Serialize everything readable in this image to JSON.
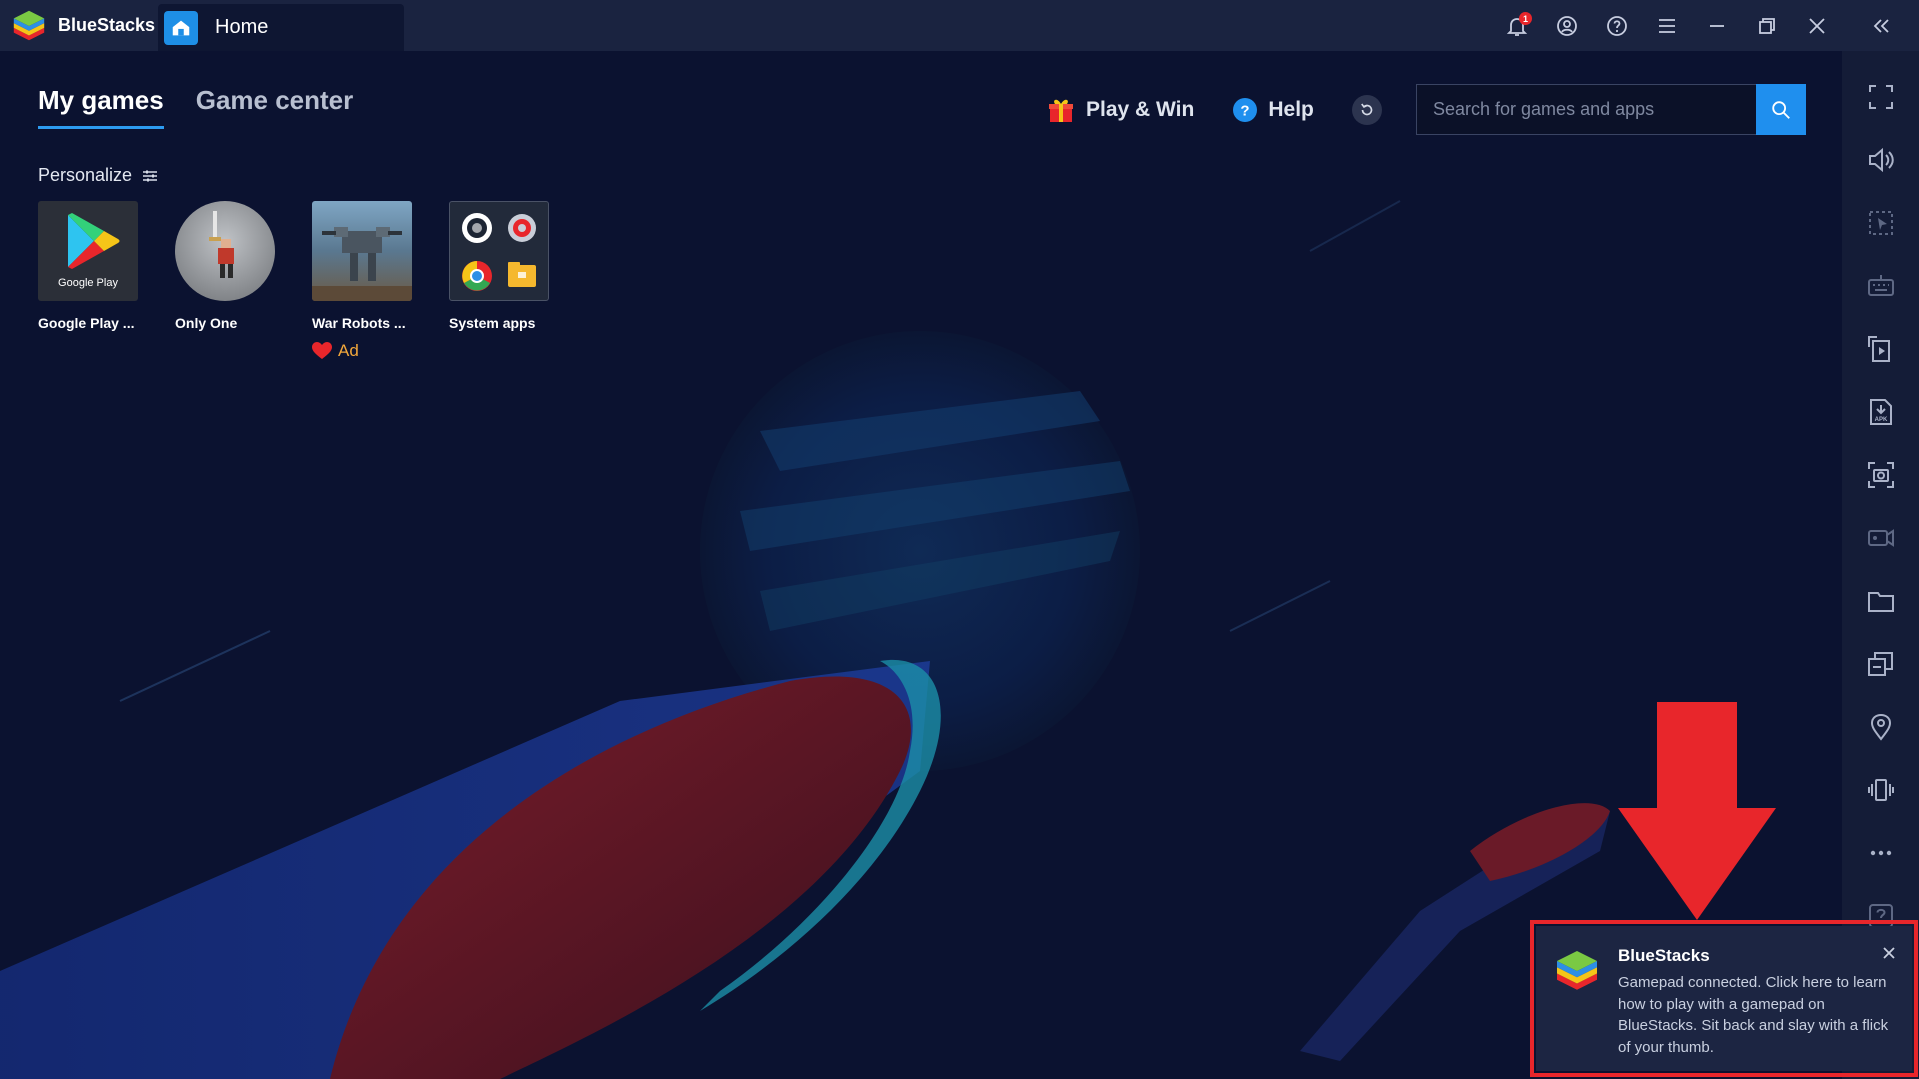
{
  "window": {
    "app_name": "BlueStacks",
    "tab_label": "Home",
    "notification_count": "1"
  },
  "nav": {
    "tabs": [
      {
        "label": "My games",
        "active": true
      },
      {
        "label": "Game center",
        "active": false
      }
    ]
  },
  "actions": {
    "play_win_label": "Play & Win",
    "help_label": "Help"
  },
  "search": {
    "placeholder": "Search for games and apps"
  },
  "personalize": {
    "label": "Personalize"
  },
  "games": [
    {
      "name": "Google Play ...",
      "thumb_caption": "Google Play"
    },
    {
      "name": "Only One"
    },
    {
      "name": "War Robots ...",
      "badge": "Ad"
    },
    {
      "name": "System apps"
    }
  ],
  "toast": {
    "title": "BlueStacks",
    "message": "Gamepad connected. Click here to learn how to play with a gamepad on BlueStacks. Sit back and slay with a flick of your thumb."
  },
  "colors": {
    "accent": "#1f8fee",
    "annotation": "#e8262b",
    "background": "#0b1230"
  },
  "sidebar_icons": [
    "fullscreen-icon",
    "volume-icon",
    "pointer-icon",
    "keyboard-icon",
    "rotate-icon",
    "apk-icon",
    "screenshot-icon",
    "record-icon",
    "folder-icon",
    "multi-instance-icon",
    "location-icon",
    "shake-icon",
    "more-icon",
    "help-icon"
  ]
}
